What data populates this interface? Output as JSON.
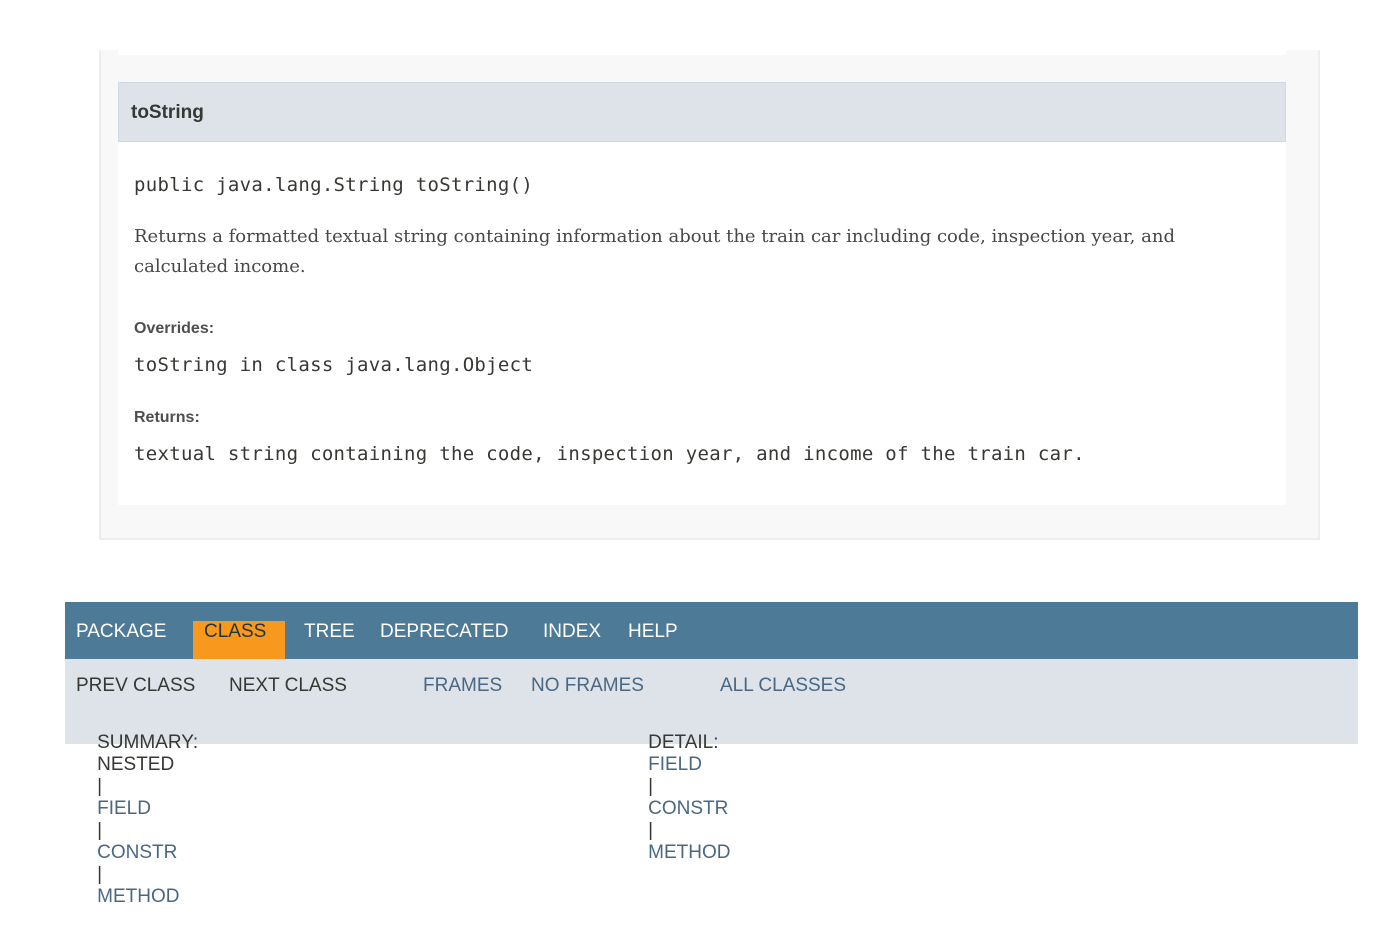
{
  "method": {
    "name": "toString",
    "signature": "public java.lang.String toString()",
    "description": "Returns a formatted textual string containing information about the train car including code, inspection year, and calculated income.",
    "overrides_label": "Overrides:",
    "overrides_value": "toString in class java.lang.Object",
    "returns_label": "Returns:",
    "returns_value": "textual string containing the code, inspection year, and income of the train car."
  },
  "nav": {
    "top": [
      {
        "label": "PACKAGE",
        "active": false
      },
      {
        "label": "CLASS",
        "active": true
      },
      {
        "label": "TREE",
        "active": false
      },
      {
        "label": "DEPRECATED",
        "active": false
      },
      {
        "label": "INDEX",
        "active": false
      },
      {
        "label": "HELP",
        "active": false
      }
    ],
    "prev_class": "PREV CLASS",
    "next_class": "NEXT CLASS",
    "frames": "FRAMES",
    "no_frames": "NO FRAMES",
    "all_classes": "ALL CLASSES",
    "summary": {
      "label": "SUMMARY:",
      "nested": "NESTED",
      "field": "FIELD",
      "constr": "CONSTR",
      "method": "METHOD",
      "sep": "|"
    },
    "detail": {
      "label": "DETAIL:",
      "field": "FIELD",
      "constr": "CONSTR",
      "method": "METHOD",
      "sep": "|"
    }
  },
  "colors": {
    "nav_bg": "#4d7a97",
    "nav_active": "#f8981d",
    "subnav_bg": "#dee3e9",
    "link": "#4a6782",
    "header_bg": "#dee3e9"
  }
}
